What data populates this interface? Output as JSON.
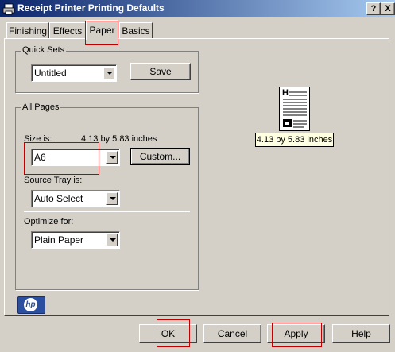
{
  "window": {
    "title": "Receipt Printer Printing Defaults",
    "help_button": "?",
    "close_button": "X"
  },
  "tabs": [
    {
      "label": "Finishing"
    },
    {
      "label": "Effects"
    },
    {
      "label": "Paper"
    },
    {
      "label": "Basics"
    }
  ],
  "active_tab": "Paper",
  "quick_sets": {
    "legend": "Quick Sets",
    "selected": "Untitled",
    "save_label": "Save"
  },
  "all_pages": {
    "legend": "All Pages",
    "size_label": "Size is:",
    "size_value": "4.13 by 5.83 inches",
    "size_selected": "A6",
    "custom_label": "Custom...",
    "source_tray_label": "Source Tray is:",
    "source_tray_selected": "Auto Select",
    "optimize_label": "Optimize for:",
    "optimize_selected": "Plain Paper"
  },
  "preview": {
    "letter": "H",
    "caption": "4.13 by 5.83 inches"
  },
  "logo": {
    "text": "hp"
  },
  "footer": {
    "ok_label": "OK",
    "cancel_label": "Cancel",
    "apply_label": "Apply",
    "help_label": "Help"
  },
  "colors": {
    "titlebar_start": "#0a246a",
    "titlebar_end": "#a6caf0",
    "highlight": "#c00000",
    "hp_blue": "#2a4fa0"
  }
}
